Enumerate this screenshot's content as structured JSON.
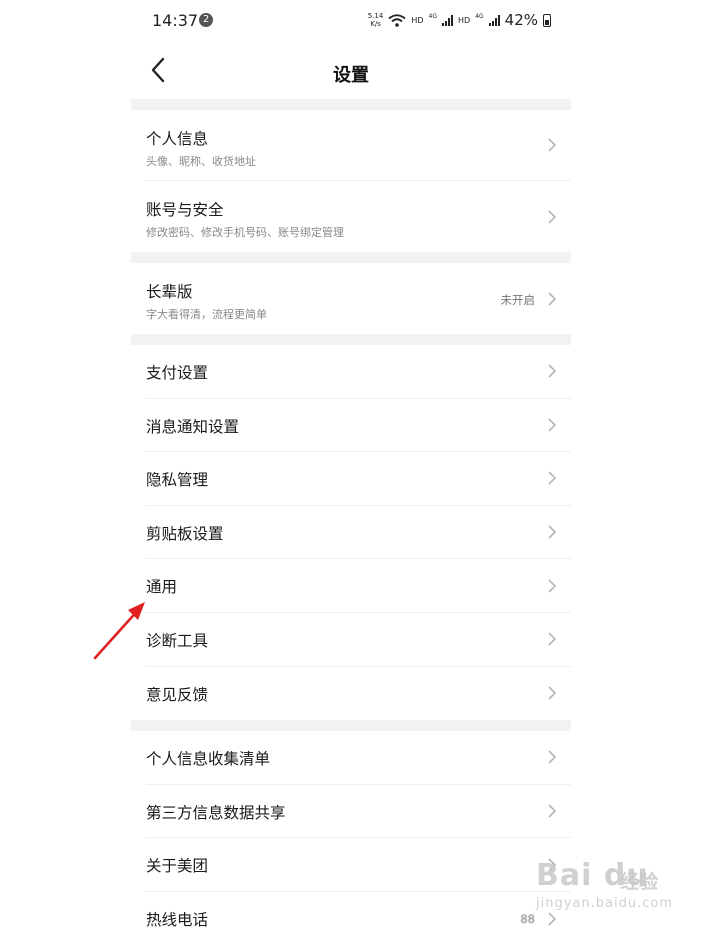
{
  "status_bar": {
    "time": "14:37",
    "notification_count": "2",
    "net_speed_value": "5.14",
    "net_speed_unit": "K/s",
    "hd1": "HD",
    "net1": "4G",
    "hd2": "HD",
    "net2": "4G",
    "battery": "42%"
  },
  "header": {
    "title": "设置",
    "back_icon": "chevron-left-icon"
  },
  "groups": [
    {
      "rows": [
        {
          "title": "个人信息",
          "subtitle": "头像、昵称、收货地址"
        },
        {
          "title": "账号与安全",
          "subtitle": "修改密码、修改手机号码、账号绑定管理"
        }
      ]
    },
    {
      "rows": [
        {
          "title": "长辈版",
          "subtitle": "字大看得清，流程更简单",
          "value": "未开启"
        }
      ]
    },
    {
      "rows": [
        {
          "title": "支付设置"
        },
        {
          "title": "消息通知设置"
        },
        {
          "title": "隐私管理"
        },
        {
          "title": "剪贴板设置"
        },
        {
          "title": "通用"
        },
        {
          "title": "诊断工具"
        },
        {
          "title": "意见反馈"
        }
      ]
    },
    {
      "rows": [
        {
          "title": "个人信息收集清单"
        },
        {
          "title": "第三方信息数据共享"
        },
        {
          "title": "关于美团"
        },
        {
          "title": "热线电话",
          "value": "88"
        }
      ]
    }
  ],
  "annotation": {
    "color": "#e02020"
  },
  "watermark": {
    "logo": "Bai du",
    "text": "经验",
    "url": "jingyan.baidu.com"
  },
  "colors": {
    "background": "#f2f2f2",
    "card": "#ffffff",
    "chevron": "#b5b5b5"
  }
}
